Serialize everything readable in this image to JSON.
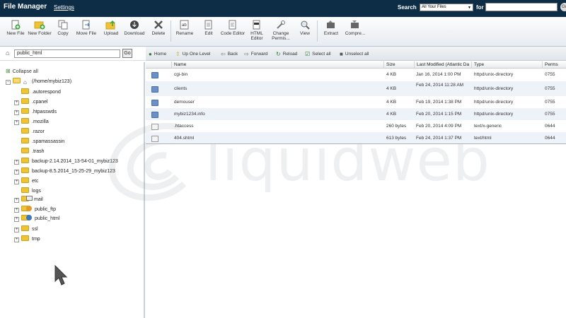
{
  "header": {
    "title": "File Manager",
    "settings": "Settings",
    "search_label": "Search",
    "search_scope": "All Your Files",
    "for_label": "for",
    "search_value": ""
  },
  "toolbar": [
    {
      "label": "New File",
      "icon": "new-file-icon"
    },
    {
      "label": "New Folder",
      "icon": "new-folder-icon"
    },
    {
      "label": "Copy",
      "icon": "copy-icon"
    },
    {
      "label": "Move File",
      "icon": "move-file-icon"
    },
    {
      "label": "Upload",
      "icon": "upload-icon"
    },
    {
      "label": "Download",
      "icon": "download-icon"
    },
    {
      "label": "Delete",
      "icon": "delete-icon"
    },
    {
      "label": "Rename",
      "icon": "rename-icon"
    },
    {
      "label": "Edit",
      "icon": "edit-icon"
    },
    {
      "label": "Code Editor",
      "icon": "code-editor-icon"
    },
    {
      "label": "HTML Editor",
      "icon": "html-editor-icon"
    },
    {
      "label": "Change Permis...",
      "icon": "change-permissions-icon"
    },
    {
      "label": "View",
      "icon": "view-icon"
    },
    {
      "label": "Extract",
      "icon": "extract-icon"
    },
    {
      "label": "Compre...",
      "icon": "compress-icon"
    }
  ],
  "path": {
    "value": "public_html",
    "go": "Go"
  },
  "nav": {
    "home": "Home",
    "up": "Up One Level",
    "back": "Back",
    "forward": "Forward",
    "reload": "Reload",
    "select_all": "Select all",
    "unselect_all": "Unselect all"
  },
  "tree": {
    "collapse_all": "Collapse all",
    "root": "(/home/mybiz123)",
    "items": [
      ".autorespond",
      ".cpanel",
      ".htpasswds",
      ".mozilla",
      ".razor",
      ".spamassassin",
      ".trash",
      "backup-2.14.2014_13-54-01_mybiz123",
      "backup-8.5.2014_15-25-29_mybiz123",
      "etc",
      "logs",
      "mail",
      "public_ftp",
      "public_html",
      "ssl",
      "tmp"
    ]
  },
  "table": {
    "columns": [
      "Name",
      "Size",
      "Last Modified (Atlantic Da",
      "Type",
      "Perms"
    ],
    "rows": [
      {
        "name": "cgi-bin",
        "size": "4 KB",
        "modified": "Jan 16, 2014 1:00 PM",
        "type": "httpd/unix-directory",
        "perms": "0755",
        "icon": "folder-icon"
      },
      {
        "name": "clients",
        "size": "4 KB",
        "modified": "Feb 24, 2014 11:28 AM",
        "type": "httpd/unix-directory",
        "perms": "0755",
        "icon": "folder-icon"
      },
      {
        "name": "demouser",
        "size": "4 KB",
        "modified": "Feb 19, 2014 1:38 PM",
        "type": "httpd/unix-directory",
        "perms": "0755",
        "icon": "folder-icon"
      },
      {
        "name": "mybiz1234.info",
        "size": "4 KB",
        "modified": "Feb 20, 2014 1:15 PM",
        "type": "httpd/unix-directory",
        "perms": "0755",
        "icon": "folder-icon"
      },
      {
        "name": ".htaccess",
        "size": "260 bytes",
        "modified": "Feb 20, 2014 4:09 PM",
        "type": "text/x-generic",
        "perms": "0644",
        "icon": "document-icon"
      },
      {
        "name": "404.shtml",
        "size": "613 bytes",
        "modified": "Feb 24, 2014 1:37 PM",
        "type": "text/html",
        "perms": "0644",
        "icon": "html-file-icon"
      }
    ]
  },
  "watermark": "liquidweb"
}
